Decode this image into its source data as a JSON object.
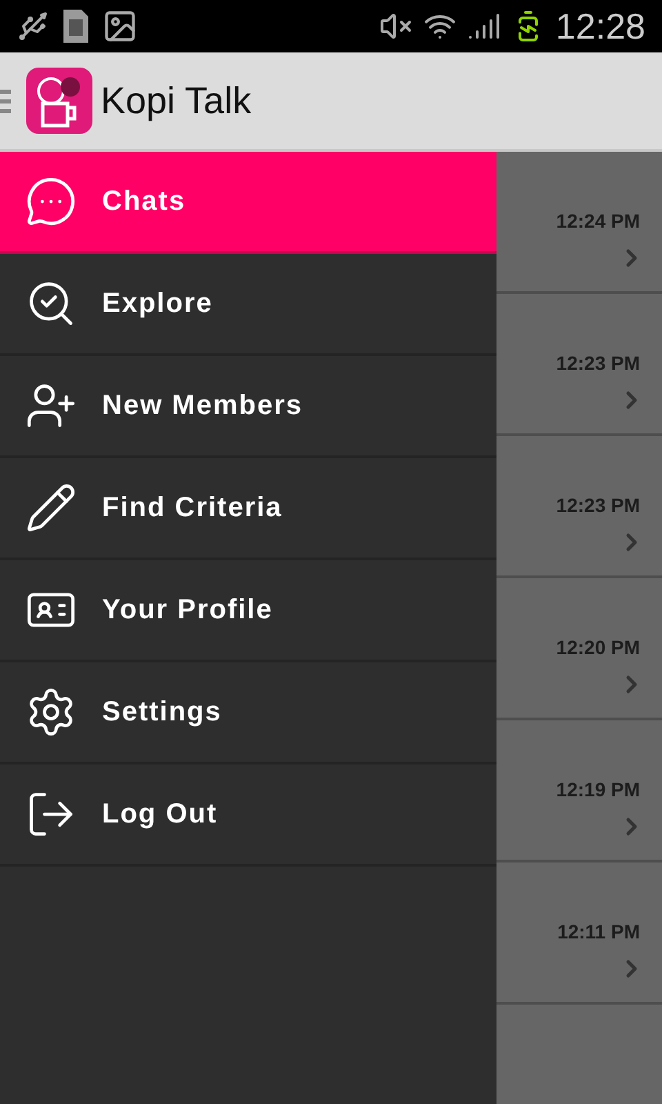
{
  "status_bar": {
    "time": "12:28"
  },
  "app_bar": {
    "title": "Kopi Talk"
  },
  "menu": [
    {
      "label": "Chats",
      "selected": true
    },
    {
      "label": "Explore",
      "selected": false
    },
    {
      "label": "New Members",
      "selected": false
    },
    {
      "label": "Find Criteria",
      "selected": false
    },
    {
      "label": "Your Profile",
      "selected": false
    },
    {
      "label": "Settings",
      "selected": false
    },
    {
      "label": "Log Out",
      "selected": false
    }
  ],
  "chats": [
    {
      "time": "12:24 PM"
    },
    {
      "time": "12:23 PM"
    },
    {
      "time": "12:23 PM"
    },
    {
      "time": "12:20 PM"
    },
    {
      "time": "12:19 PM"
    },
    {
      "time": "12:11 PM"
    }
  ]
}
